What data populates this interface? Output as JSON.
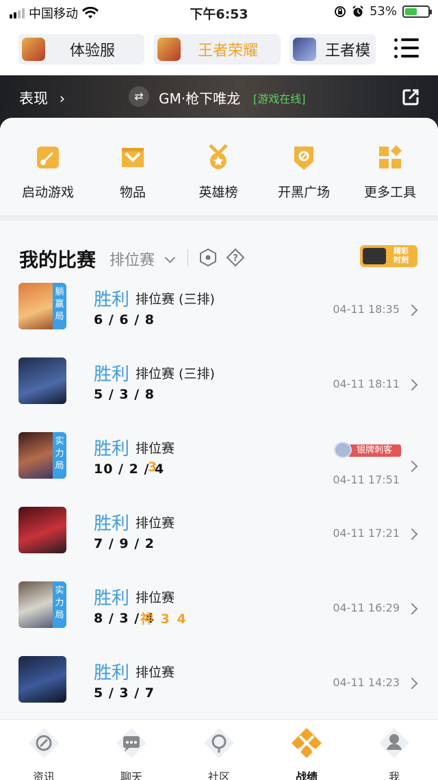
{
  "status": {
    "carrier": "中国移动",
    "time": "下午6:53",
    "battery": "53%",
    "battery_level": 0.53
  },
  "game_tabs": [
    {
      "label": "体验服"
    },
    {
      "label": "王者荣耀",
      "active": true
    },
    {
      "label": "王者模"
    }
  ],
  "banner": {
    "performance_label": "表现",
    "player": "GM·枪下唯龙",
    "online_status": "[游戏在线]"
  },
  "tools": [
    {
      "label": "启动游戏",
      "icon": "launch-game-icon"
    },
    {
      "label": "物品",
      "icon": "items-icon"
    },
    {
      "label": "英雄榜",
      "icon": "hero-rank-icon"
    },
    {
      "label": "开黑广场",
      "icon": "team-square-icon"
    },
    {
      "label": "更多工具",
      "icon": "more-tools-icon"
    }
  ],
  "section": {
    "title": "我的比赛",
    "filter": "排位赛",
    "highlight_badge": [
      "精彩",
      "时刻"
    ]
  },
  "matches": [
    {
      "result": "胜利",
      "mode": "排位赛 (三排)",
      "kda": "6 / 6 / 8",
      "extra": "",
      "time": "04-11 18:35",
      "tag": [
        "躺",
        "赢",
        "局"
      ],
      "medal": ""
    },
    {
      "result": "胜利",
      "mode": "排位赛 (三排)",
      "kda": "5 / 3 / 8",
      "extra": "",
      "time": "04-11 18:11",
      "tag": [],
      "medal": ""
    },
    {
      "result": "胜利",
      "mode": "排位赛",
      "kda": "10 / 2 / 4",
      "extra": "3",
      "time": "04-11 17:51",
      "tag": [
        "实",
        "力",
        "局"
      ],
      "medal": "银牌刺客"
    },
    {
      "result": "胜利",
      "mode": "排位赛",
      "kda": "7 / 9 / 2",
      "extra": "",
      "time": "04-11 17:21",
      "tag": [],
      "medal": ""
    },
    {
      "result": "胜利",
      "mode": "排位赛",
      "kda": "8 / 3 / 4",
      "extra": "神 3 4",
      "time": "04-11 16:29",
      "tag": [
        "实",
        "力",
        "局"
      ],
      "medal": ""
    },
    {
      "result": "胜利",
      "mode": "排位赛",
      "kda": "5 / 3 / 7",
      "extra": "",
      "time": "04-11 14:23",
      "tag": [],
      "medal": ""
    }
  ],
  "bottom_nav": [
    {
      "label": "资讯",
      "icon": "news-icon"
    },
    {
      "label": "聊天",
      "icon": "chat-icon"
    },
    {
      "label": "社区",
      "icon": "community-icon"
    },
    {
      "label": "战绩",
      "icon": "record-icon",
      "active": true
    },
    {
      "label": "我",
      "icon": "profile-icon"
    }
  ],
  "colors": {
    "accent": "#f0a22b",
    "win": "#3f9cd9",
    "tag_blue": "#3b9fe6",
    "online": "#5cd260"
  }
}
